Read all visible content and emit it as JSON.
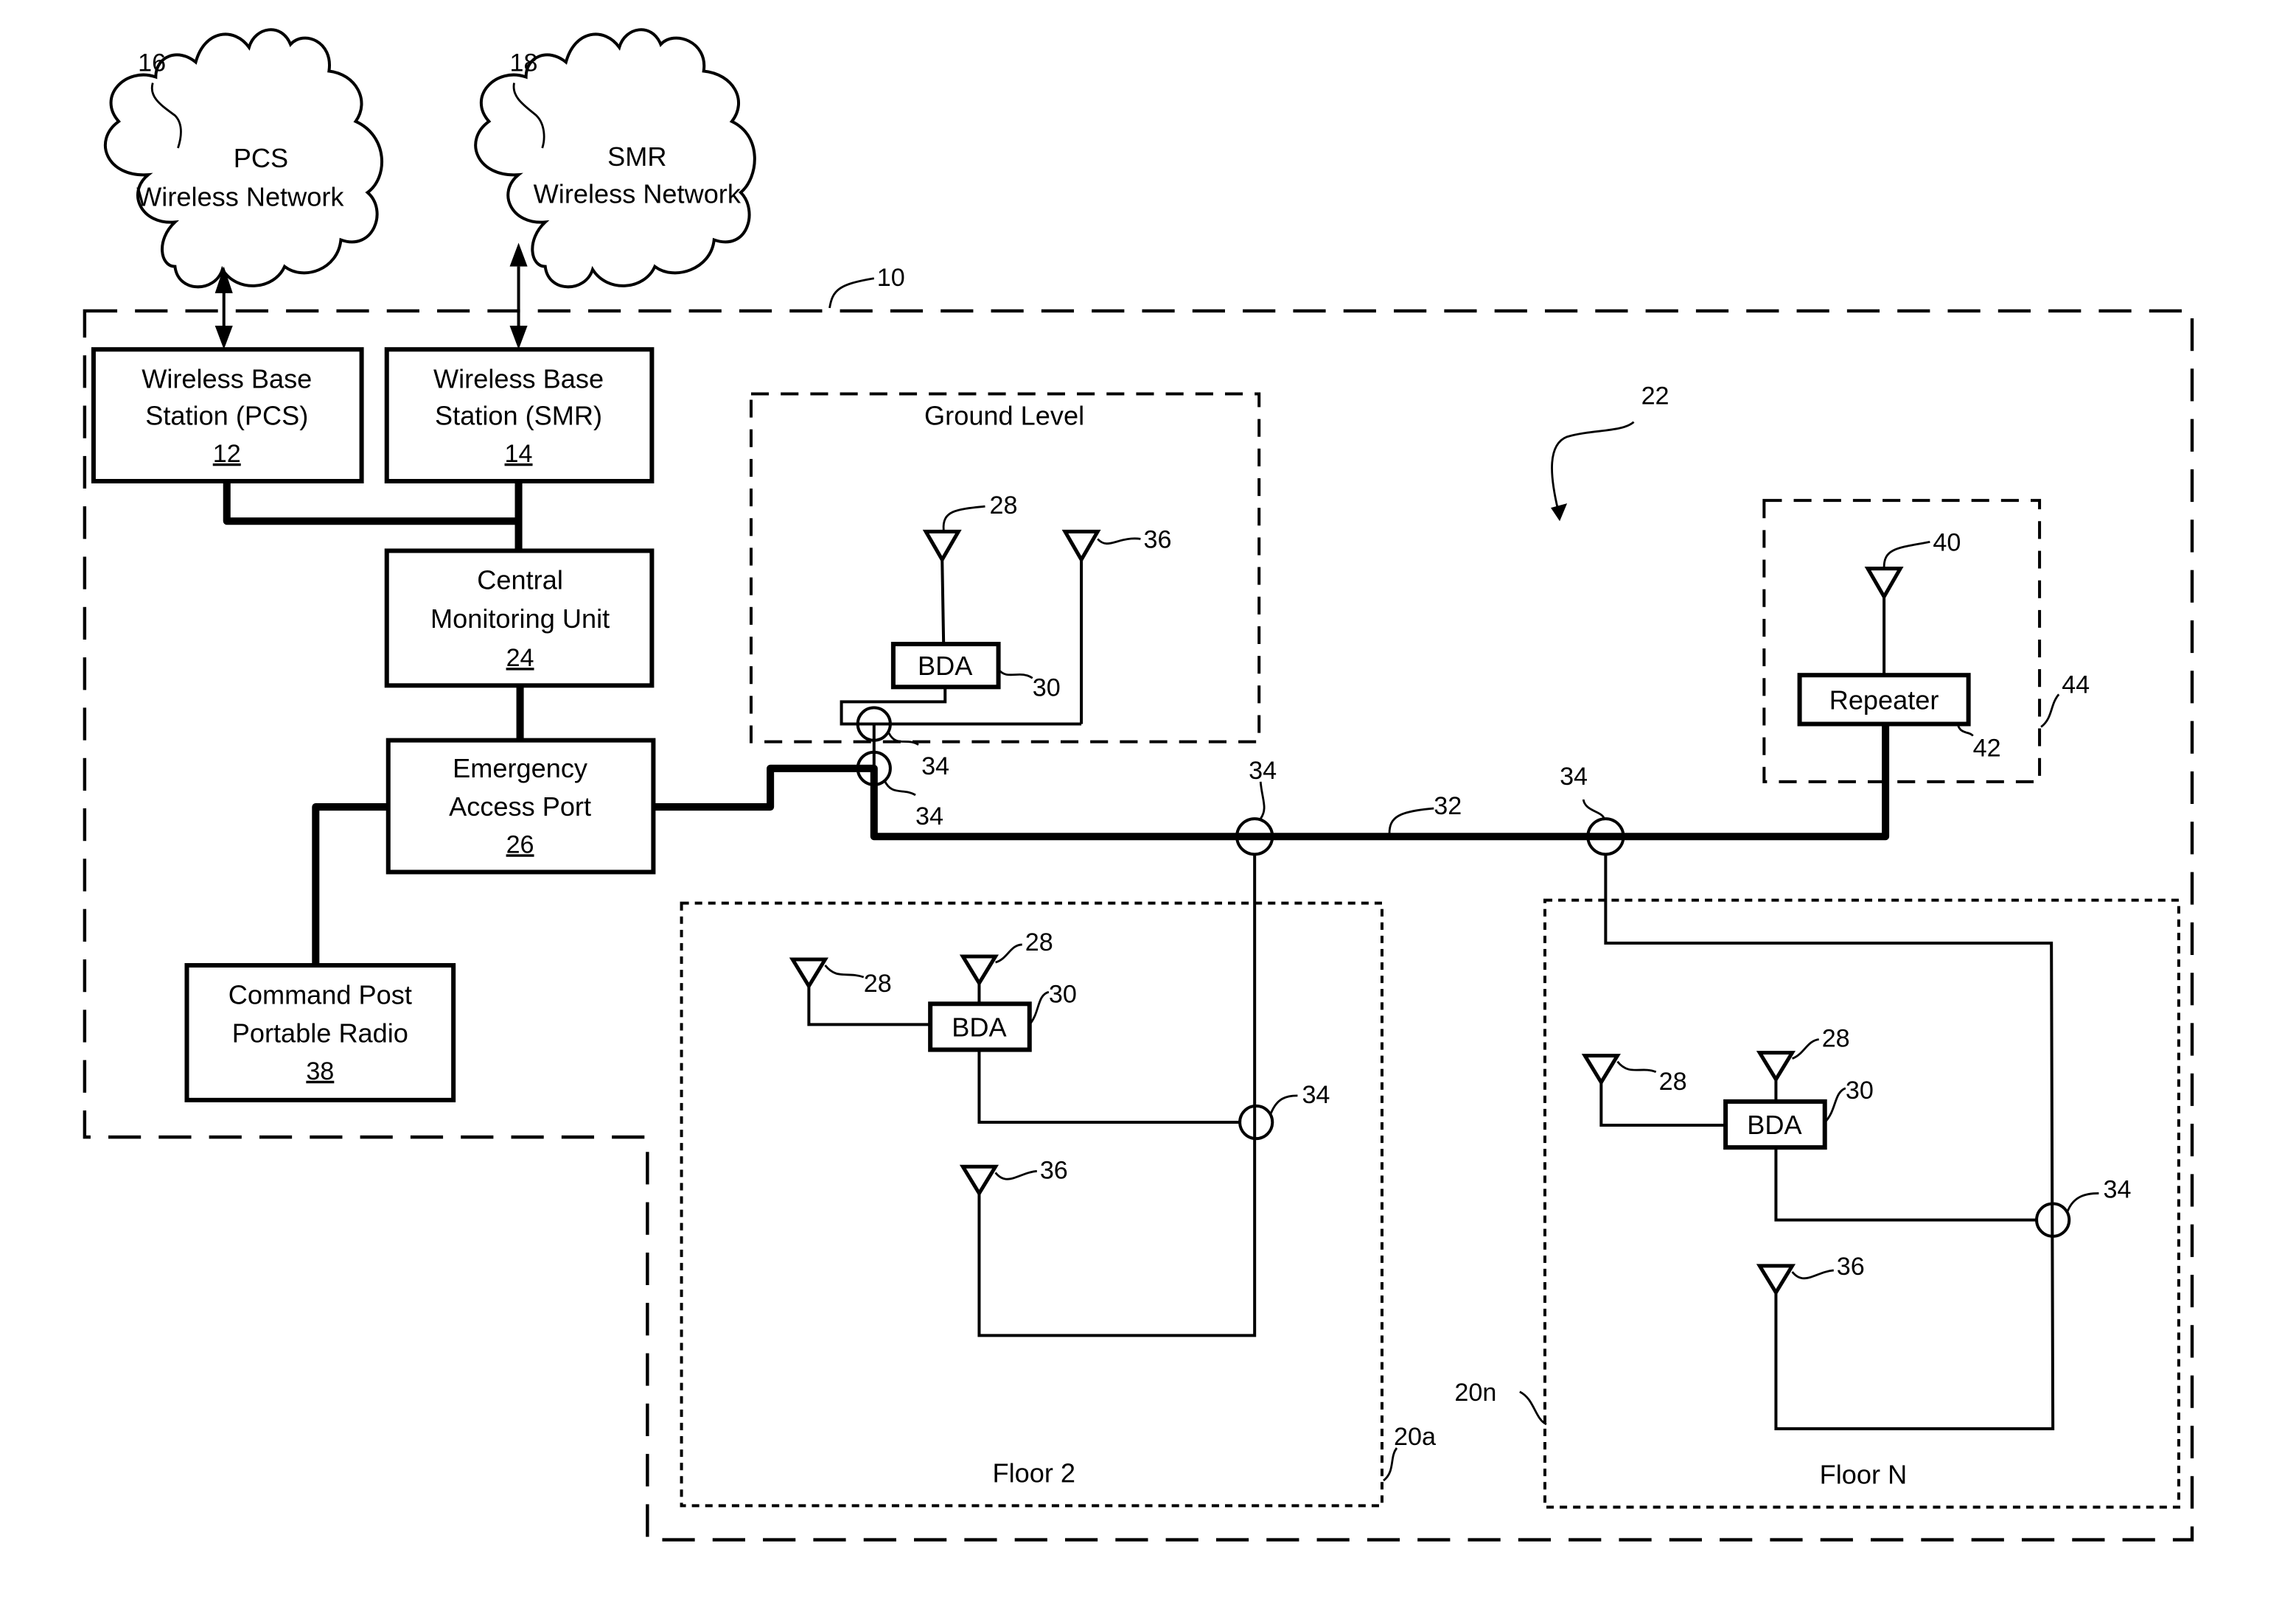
{
  "figure": {
    "system_ref": "10",
    "das_ref": "22",
    "trunk_ref": "32"
  },
  "networks": [
    {
      "title": "PCS",
      "subtitle": "Wireless Network",
      "ref": "16"
    },
    {
      "title": "SMR",
      "subtitle": "Wireless Network",
      "ref": "18"
    }
  ],
  "base_stations": [
    {
      "line1": "Wireless Base",
      "line2": "Station (PCS)",
      "ref": "12"
    },
    {
      "line1": "Wireless Base",
      "line2": "Station (SMR)",
      "ref": "14"
    }
  ],
  "central_monitoring": {
    "line1": "Central",
    "line2": "Monitoring Unit",
    "ref": "24"
  },
  "emergency_port": {
    "line1": "Emergency",
    "line2": "Access Port",
    "ref": "26"
  },
  "command_post": {
    "line1": "Command Post",
    "line2": "Portable Radio",
    "ref": "38"
  },
  "ground_level": {
    "title": "Ground Level",
    "bda_label": "BDA",
    "bda_ref": "30",
    "antenna_ref_28": "28",
    "antenna_ref_36": "36",
    "coupler_ref_upper": "34",
    "coupler_ref_lower": "34"
  },
  "trunk_couplers": [
    "34",
    "34"
  ],
  "repeater": {
    "label": "Repeater",
    "ref": "42",
    "antenna_ref": "40",
    "enclosure_ref": "44"
  },
  "floors": [
    {
      "title": "Floor 2",
      "ref": "20a",
      "bda_label": "BDA",
      "bda_ref": "30",
      "antenna_refs_28": [
        "28",
        "28"
      ],
      "antenna_ref_36": "36",
      "coupler_ref": "34"
    },
    {
      "title": "Floor N",
      "ref": "20n",
      "bda_label": "BDA",
      "bda_ref": "30",
      "antenna_refs_28": [
        "28",
        "28"
      ],
      "antenna_ref_36": "36",
      "coupler_ref": "34"
    }
  ]
}
